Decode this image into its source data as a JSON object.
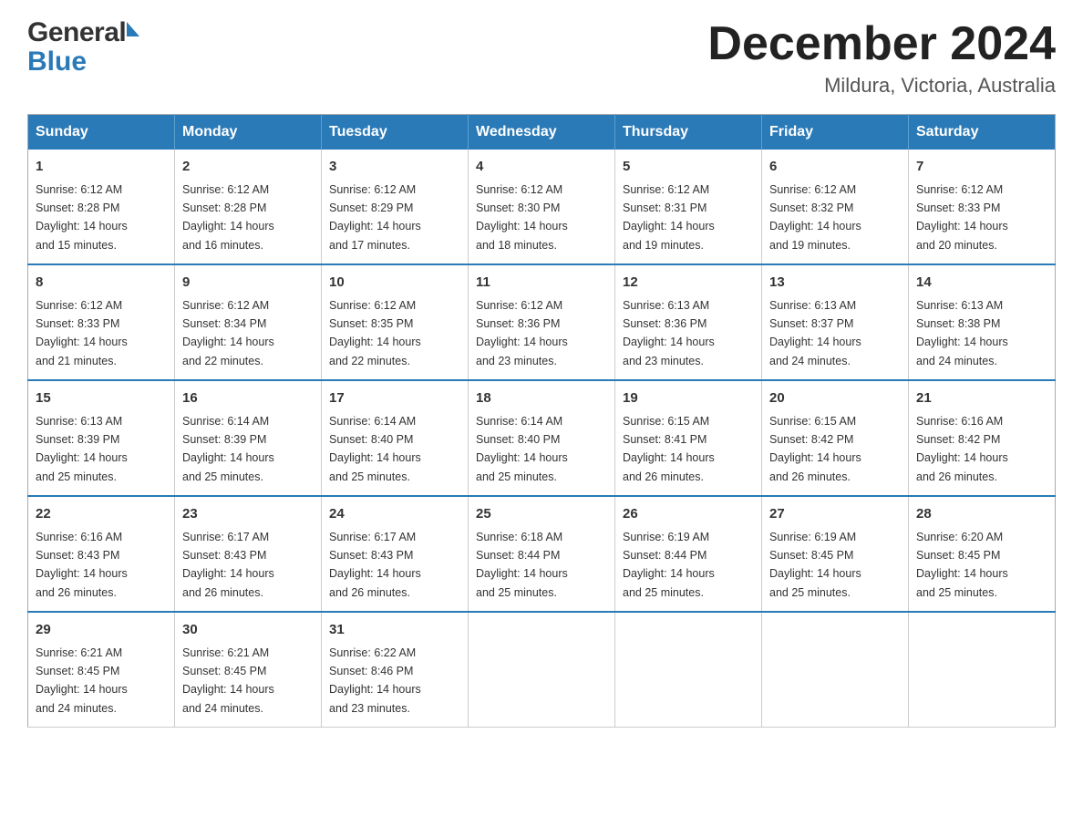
{
  "header": {
    "logo_general": "General",
    "logo_blue": "Blue",
    "month_title": "December 2024",
    "location": "Mildura, Victoria, Australia"
  },
  "days_of_week": [
    "Sunday",
    "Monday",
    "Tuesday",
    "Wednesday",
    "Thursday",
    "Friday",
    "Saturday"
  ],
  "weeks": [
    [
      {
        "day": "1",
        "sunrise": "6:12 AM",
        "sunset": "8:28 PM",
        "daylight": "14 hours and 15 minutes."
      },
      {
        "day": "2",
        "sunrise": "6:12 AM",
        "sunset": "8:28 PM",
        "daylight": "14 hours and 16 minutes."
      },
      {
        "day": "3",
        "sunrise": "6:12 AM",
        "sunset": "8:29 PM",
        "daylight": "14 hours and 17 minutes."
      },
      {
        "day": "4",
        "sunrise": "6:12 AM",
        "sunset": "8:30 PM",
        "daylight": "14 hours and 18 minutes."
      },
      {
        "day": "5",
        "sunrise": "6:12 AM",
        "sunset": "8:31 PM",
        "daylight": "14 hours and 19 minutes."
      },
      {
        "day": "6",
        "sunrise": "6:12 AM",
        "sunset": "8:32 PM",
        "daylight": "14 hours and 19 minutes."
      },
      {
        "day": "7",
        "sunrise": "6:12 AM",
        "sunset": "8:33 PM",
        "daylight": "14 hours and 20 minutes."
      }
    ],
    [
      {
        "day": "8",
        "sunrise": "6:12 AM",
        "sunset": "8:33 PM",
        "daylight": "14 hours and 21 minutes."
      },
      {
        "day": "9",
        "sunrise": "6:12 AM",
        "sunset": "8:34 PM",
        "daylight": "14 hours and 22 minutes."
      },
      {
        "day": "10",
        "sunrise": "6:12 AM",
        "sunset": "8:35 PM",
        "daylight": "14 hours and 22 minutes."
      },
      {
        "day": "11",
        "sunrise": "6:12 AM",
        "sunset": "8:36 PM",
        "daylight": "14 hours and 23 minutes."
      },
      {
        "day": "12",
        "sunrise": "6:13 AM",
        "sunset": "8:36 PM",
        "daylight": "14 hours and 23 minutes."
      },
      {
        "day": "13",
        "sunrise": "6:13 AM",
        "sunset": "8:37 PM",
        "daylight": "14 hours and 24 minutes."
      },
      {
        "day": "14",
        "sunrise": "6:13 AM",
        "sunset": "8:38 PM",
        "daylight": "14 hours and 24 minutes."
      }
    ],
    [
      {
        "day": "15",
        "sunrise": "6:13 AM",
        "sunset": "8:39 PM",
        "daylight": "14 hours and 25 minutes."
      },
      {
        "day": "16",
        "sunrise": "6:14 AM",
        "sunset": "8:39 PM",
        "daylight": "14 hours and 25 minutes."
      },
      {
        "day": "17",
        "sunrise": "6:14 AM",
        "sunset": "8:40 PM",
        "daylight": "14 hours and 25 minutes."
      },
      {
        "day": "18",
        "sunrise": "6:14 AM",
        "sunset": "8:40 PM",
        "daylight": "14 hours and 25 minutes."
      },
      {
        "day": "19",
        "sunrise": "6:15 AM",
        "sunset": "8:41 PM",
        "daylight": "14 hours and 26 minutes."
      },
      {
        "day": "20",
        "sunrise": "6:15 AM",
        "sunset": "8:42 PM",
        "daylight": "14 hours and 26 minutes."
      },
      {
        "day": "21",
        "sunrise": "6:16 AM",
        "sunset": "8:42 PM",
        "daylight": "14 hours and 26 minutes."
      }
    ],
    [
      {
        "day": "22",
        "sunrise": "6:16 AM",
        "sunset": "8:43 PM",
        "daylight": "14 hours and 26 minutes."
      },
      {
        "day": "23",
        "sunrise": "6:17 AM",
        "sunset": "8:43 PM",
        "daylight": "14 hours and 26 minutes."
      },
      {
        "day": "24",
        "sunrise": "6:17 AM",
        "sunset": "8:43 PM",
        "daylight": "14 hours and 26 minutes."
      },
      {
        "day": "25",
        "sunrise": "6:18 AM",
        "sunset": "8:44 PM",
        "daylight": "14 hours and 25 minutes."
      },
      {
        "day": "26",
        "sunrise": "6:19 AM",
        "sunset": "8:44 PM",
        "daylight": "14 hours and 25 minutes."
      },
      {
        "day": "27",
        "sunrise": "6:19 AM",
        "sunset": "8:45 PM",
        "daylight": "14 hours and 25 minutes."
      },
      {
        "day": "28",
        "sunrise": "6:20 AM",
        "sunset": "8:45 PM",
        "daylight": "14 hours and 25 minutes."
      }
    ],
    [
      {
        "day": "29",
        "sunrise": "6:21 AM",
        "sunset": "8:45 PM",
        "daylight": "14 hours and 24 minutes."
      },
      {
        "day": "30",
        "sunrise": "6:21 AM",
        "sunset": "8:45 PM",
        "daylight": "14 hours and 24 minutes."
      },
      {
        "day": "31",
        "sunrise": "6:22 AM",
        "sunset": "8:46 PM",
        "daylight": "14 hours and 23 minutes."
      },
      null,
      null,
      null,
      null
    ]
  ],
  "labels": {
    "sunrise": "Sunrise:",
    "sunset": "Sunset:",
    "daylight": "Daylight:"
  }
}
